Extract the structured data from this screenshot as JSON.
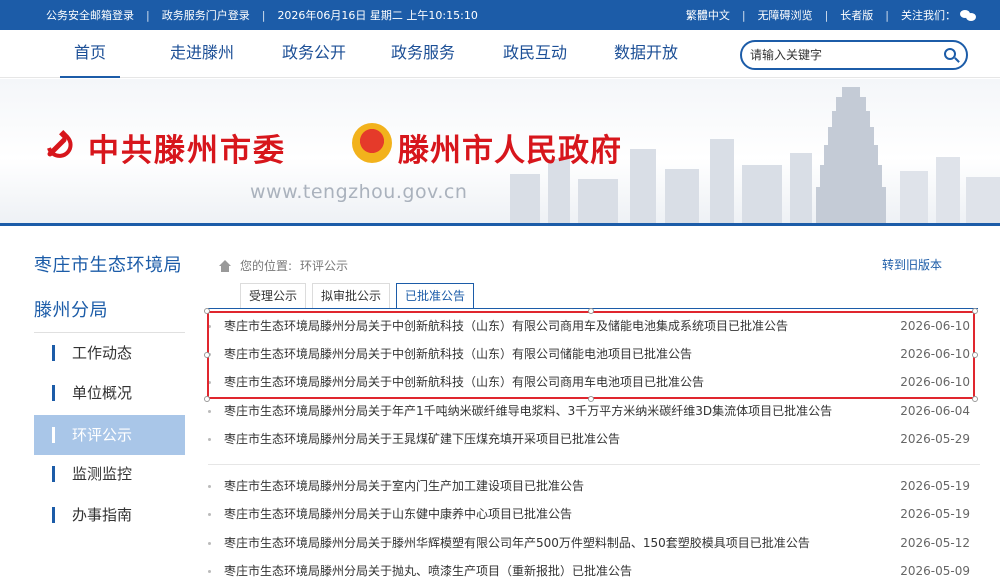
{
  "topbar": {
    "left": [
      "公务安全邮箱登录",
      "政务服务门户登录",
      "2026年06月16日 星期二 上午10:15:10"
    ],
    "right": [
      "繁體中文",
      "无障碍浏览",
      "长者版",
      "关注我们："
    ]
  },
  "nav": {
    "items": [
      "首页",
      "走进滕州",
      "政务公开",
      "政务服务",
      "政民互动",
      "数据开放"
    ],
    "search_placeholder": "请输入关键字"
  },
  "banner": {
    "org1": "中共滕州市委",
    "org2": "滕州市人民政府",
    "domain": "www.tengzhou.gov.cn"
  },
  "sidebar": {
    "title_line1": "枣庄市生态环境局",
    "title_line2": "滕州分局",
    "items": [
      "工作动态",
      "单位概况",
      "环评公示",
      "监测监控",
      "办事指南"
    ],
    "active_index": 2
  },
  "breadcrumb": {
    "prefix": "您的位置:",
    "current": "环评公示"
  },
  "old_version_link": "转到旧版本",
  "tabs": [
    "受理公示",
    "拟审批公示",
    "已批准公告"
  ],
  "active_tab_index": 2,
  "list": [
    {
      "title": "枣庄市生态环境局滕州分局关于中创新航科技（山东）有限公司商用车及储能电池集成系统项目已批准公告",
      "date": "2026-06-10"
    },
    {
      "title": "枣庄市生态环境局滕州分局关于中创新航科技（山东）有限公司储能电池项目已批准公告",
      "date": "2026-06-10"
    },
    {
      "title": "枣庄市生态环境局滕州分局关于中创新航科技（山东）有限公司商用车电池项目已批准公告",
      "date": "2026-06-10"
    },
    {
      "title": "枣庄市生态环境局滕州分局关于年产1千吨纳米碳纤维导电浆料、3千万平方米纳米碳纤维3D集流体项目已批准公告",
      "date": "2026-06-04"
    },
    {
      "title": "枣庄市生态环境局滕州分局关于王晁煤矿建下压煤充填开采项目已批准公告",
      "date": "2026-05-29"
    },
    {
      "title": "枣庄市生态环境局滕州分局关于室内门生产加工建设项目已批准公告",
      "date": "2026-05-19"
    },
    {
      "title": "枣庄市生态环境局滕州分局关于山东健中康养中心项目已批准公告",
      "date": "2026-05-19"
    },
    {
      "title": "枣庄市生态环境局滕州分局关于滕州华辉模塑有限公司年产500万件塑料制品、150套塑胶模具项目已批准公告",
      "date": "2026-05-12"
    },
    {
      "title": "枣庄市生态环境局滕州分局关于抛丸、喷漆生产项目（重新报批）已批准公告",
      "date": "2026-05-09"
    }
  ],
  "colors": {
    "brand_blue": "#1c5ca8",
    "highlight_red": "#e0262e",
    "title_red": "#d7161c"
  }
}
